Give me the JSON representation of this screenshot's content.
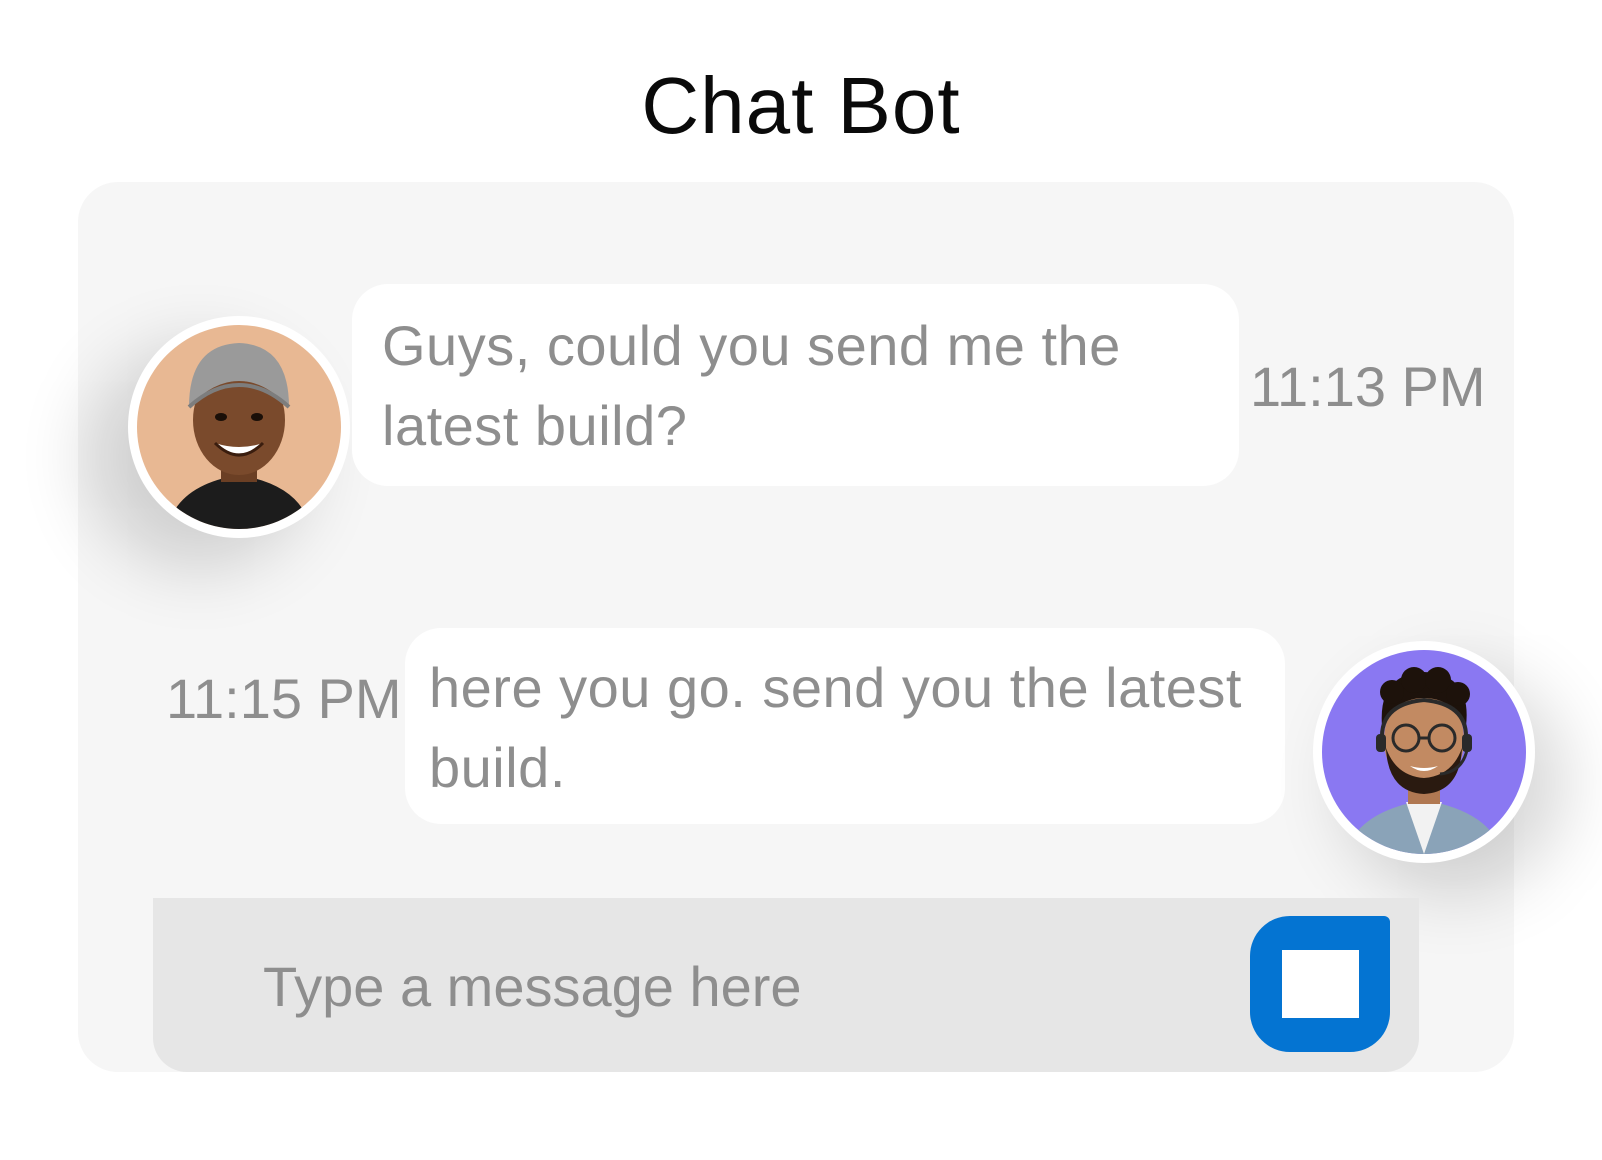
{
  "header": {
    "title": "Chat Bot"
  },
  "messages": [
    {
      "sender": "user",
      "text": "Guys, could you send me the latest build?",
      "time": "11:13 PM"
    },
    {
      "sender": "agent",
      "text": "here you go. send you the latest build.",
      "time": "11:15 PM"
    }
  ],
  "composer": {
    "placeholder": "Type a message here",
    "value": ""
  },
  "icons": {
    "send": "stop-square-icon"
  },
  "colors": {
    "panel_bg": "#f6f6f6",
    "input_bg": "#e6e6e6",
    "bubble_bg": "#ffffff",
    "text_gray": "#8e8e8e",
    "send_button": "#0474d2",
    "user_avatar_bg": "#e8b893",
    "agent_avatar_bg": "#8a78f2"
  }
}
